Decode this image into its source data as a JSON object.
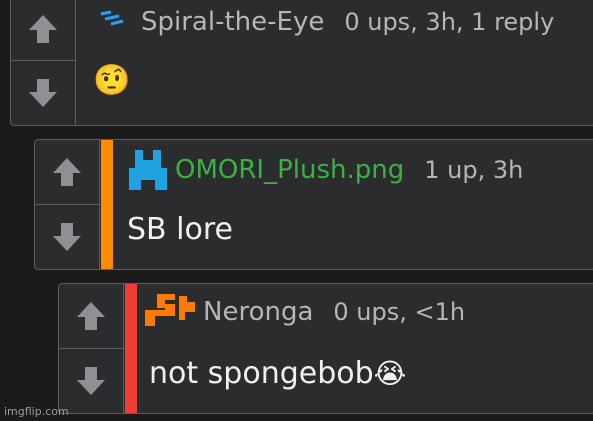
{
  "comments": [
    {
      "username": "Spiral-the-Eye",
      "meta": "0 ups, 3h, 1 reply",
      "text": "",
      "emoji": "🤨",
      "username_color": "#b5b6b8",
      "stripe_color": null,
      "avatar_icon": "spiral-avatar-icon"
    },
    {
      "username": "OMORI_Plush.png",
      "meta": "1 up, 3h",
      "text": "SB lore",
      "emoji": "",
      "username_color": "#3cb043",
      "stripe_color": "#ff8c00",
      "avatar_icon": "blue-pixel-avatar-icon"
    },
    {
      "username": "Neronga",
      "meta": "0 ups, <1h",
      "text": "not spongebob",
      "emoji": "😭",
      "username_color": "#b5b6b8",
      "stripe_color": "#f03c32",
      "avatar_icon": "orange-pixel-avatar-icon"
    }
  ],
  "watermark": "imgflip.com"
}
